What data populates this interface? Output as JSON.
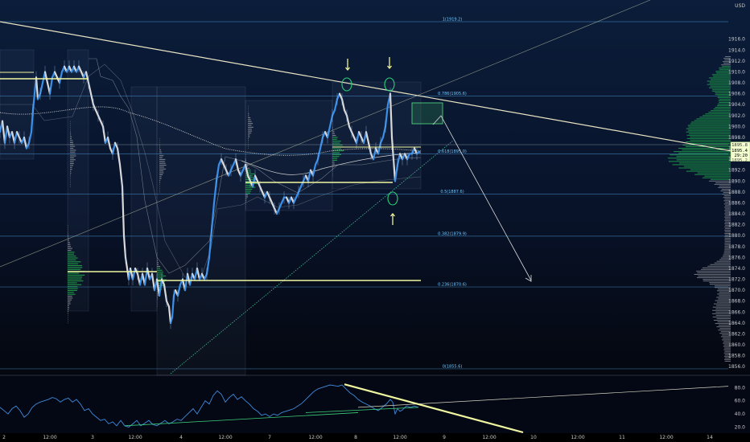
{
  "chart_data": {
    "type": "line",
    "currency": "USD",
    "price_axis": {
      "ylim": [
        1855,
        1922
      ],
      "ticks": [
        "1916.0",
        "1914.0",
        "1912.0",
        "1910.0",
        "1908.0",
        "1906.0",
        "1904.0",
        "1902.0",
        "1900.0",
        "1898.0",
        "1896.0",
        "1894.0",
        "1892.0",
        "1890.0",
        "1888.0",
        "1886.0",
        "1884.0",
        "1882.0",
        "1880.0",
        "1878.0",
        "1876.0",
        "1874.0",
        "1872.0",
        "1870.0",
        "1868.0",
        "1866.0",
        "1864.0",
        "1862.0",
        "1860.0",
        "1858.0",
        "1856.0"
      ]
    },
    "time_axis": {
      "labels": [
        "2",
        "12:00",
        "3",
        "12:00",
        "4",
        "12:00",
        "7",
        "12:00",
        "8",
        "12:00",
        "9",
        "12:00",
        "10",
        "12:00",
        "11",
        "12:00",
        "14"
      ]
    },
    "last_price": {
      "value": 1895.4,
      "label": "1895.4",
      "countdown": "29:20",
      "high_label": "1895.8",
      "low_label": "1895.2"
    },
    "fib_levels": [
      {
        "ratio": "1",
        "price": 1919.2,
        "label": "1(1919.2)"
      },
      {
        "ratio": "0.786",
        "price": 1905.6,
        "label": "0.786(1905.6)"
      },
      {
        "ratio": "0.618",
        "price": 1895.0,
        "label": "0.618(1895.0)"
      },
      {
        "ratio": "0.5",
        "price": 1887.6,
        "label": "0.5(1887.6)"
      },
      {
        "ratio": "0.382",
        "price": 1879.9,
        "label": "0.382(1879.9)"
      },
      {
        "ratio": "0.236",
        "price": 1870.6,
        "label": "0.236(1870.6)"
      },
      {
        "ratio": "0",
        "price": 1855.6,
        "label": "0(1855.6)"
      }
    ],
    "price_series": [
      [
        0,
        1899
      ],
      [
        3,
        1901
      ],
      [
        6,
        1897
      ],
      [
        9,
        1900
      ],
      [
        12,
        1898
      ],
      [
        15,
        1899
      ],
      [
        18,
        1897
      ],
      [
        21,
        1899
      ],
      [
        24,
        1898
      ],
      [
        27,
        1897
      ],
      [
        30,
        1898
      ],
      [
        33,
        1896
      ],
      [
        36,
        1897
      ],
      [
        39,
        1899
      ],
      [
        41,
        1903
      ],
      [
        43,
        1906
      ],
      [
        45,
        1909
      ],
      [
        47,
        1905
      ],
      [
        50,
        1906
      ],
      [
        53,
        1908
      ],
      [
        56,
        1910
      ],
      [
        59,
        1908
      ],
      [
        62,
        1906
      ],
      [
        65,
        1909
      ],
      [
        68,
        1910
      ],
      [
        71,
        1909
      ],
      [
        74,
        1908
      ],
      [
        77,
        1910
      ],
      [
        80,
        1911
      ],
      [
        83,
        1910
      ],
      [
        86,
        1911
      ],
      [
        89,
        1910
      ],
      [
        92,
        1911
      ],
      [
        95,
        1910
      ],
      [
        98,
        1911
      ],
      [
        101,
        1910
      ],
      [
        104,
        1909
      ],
      [
        107,
        1910
      ],
      [
        110,
        1908
      ],
      [
        113,
        1906
      ],
      [
        116,
        1904
      ],
      [
        119,
        1903
      ],
      [
        122,
        1902
      ],
      [
        125,
        1901
      ],
      [
        128,
        1900
      ],
      [
        131,
        1897
      ],
      [
        134,
        1898
      ],
      [
        137,
        1896
      ],
      [
        140,
        1895
      ],
      [
        143,
        1897
      ],
      [
        146,
        1896
      ],
      [
        149,
        1893
      ],
      [
        152,
        1889
      ],
      [
        154,
        1880
      ],
      [
        156,
        1876
      ],
      [
        158,
        1874
      ],
      [
        160,
        1872
      ],
      [
        162,
        1874
      ],
      [
        165,
        1872
      ],
      [
        168,
        1874
      ],
      [
        171,
        1873
      ],
      [
        174,
        1871
      ],
      [
        177,
        1873
      ],
      [
        180,
        1871
      ],
      [
        183,
        1874
      ],
      [
        186,
        1872
      ],
      [
        189,
        1873
      ],
      [
        192,
        1870
      ],
      [
        195,
        1872
      ],
      [
        198,
        1869
      ],
      [
        201,
        1872
      ],
      [
        204,
        1871
      ],
      [
        207,
        1868
      ],
      [
        210,
        1867
      ],
      [
        212,
        1864
      ],
      [
        214,
        1865
      ],
      [
        216,
        1869
      ],
      [
        218,
        1870
      ],
      [
        221,
        1869
      ],
      [
        224,
        1871
      ],
      [
        227,
        1872
      ],
      [
        230,
        1870
      ],
      [
        233,
        1873
      ],
      [
        236,
        1871
      ],
      [
        239,
        1873
      ],
      [
        242,
        1872
      ],
      [
        245,
        1874
      ],
      [
        248,
        1872
      ],
      [
        251,
        1873
      ],
      [
        254,
        1872
      ],
      [
        257,
        1873
      ],
      [
        260,
        1876
      ],
      [
        263,
        1881
      ],
      [
        266,
        1886
      ],
      [
        269,
        1890
      ],
      [
        272,
        1893
      ],
      [
        275,
        1894
      ],
      [
        278,
        1893
      ],
      [
        281,
        1892
      ],
      [
        284,
        1891
      ],
      [
        287,
        1892
      ],
      [
        290,
        1893
      ],
      [
        293,
        1894
      ],
      [
        296,
        1892
      ],
      [
        299,
        1891
      ],
      [
        302,
        1892
      ],
      [
        305,
        1893
      ],
      [
        308,
        1891
      ],
      [
        311,
        1890
      ],
      [
        314,
        1889
      ],
      [
        317,
        1891
      ],
      [
        320,
        1890
      ],
      [
        323,
        1889
      ],
      [
        326,
        1888
      ],
      [
        329,
        1887
      ],
      [
        332,
        1888
      ],
      [
        335,
        1887
      ],
      [
        338,
        1886
      ],
      [
        341,
        1885
      ],
      [
        344,
        1884
      ],
      [
        347,
        1885
      ],
      [
        350,
        1886
      ],
      [
        353,
        1887
      ],
      [
        356,
        1887
      ],
      [
        359,
        1886
      ],
      [
        362,
        1887
      ],
      [
        365,
        1886
      ],
      [
        368,
        1887
      ],
      [
        371,
        1888
      ],
      [
        374,
        1889
      ],
      [
        377,
        1890
      ],
      [
        380,
        1891
      ],
      [
        383,
        1890
      ],
      [
        386,
        1892
      ],
      [
        389,
        1891
      ],
      [
        392,
        1893
      ],
      [
        395,
        1894
      ],
      [
        398,
        1896
      ],
      [
        401,
        1898
      ],
      [
        404,
        1899
      ],
      [
        407,
        1898
      ],
      [
        410,
        1900
      ],
      [
        413,
        1902
      ],
      [
        416,
        1903
      ],
      [
        419,
        1905
      ],
      [
        422,
        1906
      ],
      [
        425,
        1905
      ],
      [
        428,
        1903
      ],
      [
        431,
        1902
      ],
      [
        434,
        1900
      ],
      [
        437,
        1899
      ],
      [
        440,
        1898
      ],
      [
        443,
        1897
      ],
      [
        446,
        1899
      ],
      [
        449,
        1898
      ],
      [
        452,
        1897
      ],
      [
        455,
        1899
      ],
      [
        458,
        1897
      ],
      [
        461,
        1895
      ],
      [
        464,
        1894
      ],
      [
        467,
        1896
      ],
      [
        470,
        1895
      ],
      [
        473,
        1897
      ],
      [
        476,
        1898
      ],
      [
        479,
        1900
      ],
      [
        482,
        1904
      ],
      [
        485,
        1906
      ],
      [
        487,
        1898
      ],
      [
        489,
        1894
      ],
      [
        491,
        1890
      ],
      [
        494,
        1893
      ],
      [
        497,
        1895
      ],
      [
        500,
        1894
      ],
      [
        503,
        1895
      ],
      [
        506,
        1894
      ],
      [
        509,
        1895
      ],
      [
        512,
        1895
      ],
      [
        515,
        1896
      ],
      [
        518,
        1895
      ],
      [
        521,
        1895.4
      ]
    ],
    "oscillator": {
      "ylim": [
        12,
        95
      ],
      "ticks": [
        "80.0",
        "60.0",
        "40.0",
        "20.0"
      ],
      "values": [
        [
          0,
          50
        ],
        [
          5,
          45
        ],
        [
          10,
          40
        ],
        [
          15,
          48
        ],
        [
          20,
          52
        ],
        [
          25,
          45
        ],
        [
          30,
          35
        ],
        [
          35,
          40
        ],
        [
          40,
          50
        ],
        [
          45,
          55
        ],
        [
          50,
          58
        ],
        [
          55,
          60
        ],
        [
          60,
          62
        ],
        [
          65,
          65
        ],
        [
          70,
          63
        ],
        [
          75,
          58
        ],
        [
          80,
          62
        ],
        [
          85,
          64
        ],
        [
          90,
          58
        ],
        [
          95,
          62
        ],
        [
          100,
          55
        ],
        [
          105,
          45
        ],
        [
          110,
          48
        ],
        [
          115,
          40
        ],
        [
          120,
          35
        ],
        [
          125,
          30
        ],
        [
          130,
          32
        ],
        [
          135,
          25
        ],
        [
          140,
          28
        ],
        [
          145,
          22
        ],
        [
          150,
          30
        ],
        [
          155,
          22
        ],
        [
          160,
          20
        ],
        [
          165,
          25
        ],
        [
          170,
          30
        ],
        [
          175,
          22
        ],
        [
          180,
          26
        ],
        [
          185,
          30
        ],
        [
          190,
          24
        ],
        [
          195,
          22
        ],
        [
          200,
          26
        ],
        [
          205,
          30
        ],
        [
          210,
          25
        ],
        [
          215,
          28
        ],
        [
          220,
          32
        ],
        [
          225,
          30
        ],
        [
          230,
          36
        ],
        [
          235,
          42
        ],
        [
          240,
          48
        ],
        [
          245,
          40
        ],
        [
          250,
          50
        ],
        [
          255,
          60
        ],
        [
          260,
          55
        ],
        [
          265,
          68
        ],
        [
          270,
          75
        ],
        [
          275,
          70
        ],
        [
          280,
          58
        ],
        [
          285,
          65
        ],
        [
          290,
          70
        ],
        [
          295,
          62
        ],
        [
          300,
          66
        ],
        [
          305,
          60
        ],
        [
          310,
          55
        ],
        [
          315,
          48
        ],
        [
          320,
          44
        ],
        [
          325,
          38
        ],
        [
          330,
          40
        ],
        [
          335,
          36
        ],
        [
          340,
          40
        ],
        [
          345,
          38
        ],
        [
          350,
          42
        ],
        [
          355,
          44
        ],
        [
          360,
          46
        ],
        [
          365,
          48
        ],
        [
          370,
          52
        ],
        [
          375,
          56
        ],
        [
          380,
          62
        ],
        [
          385,
          68
        ],
        [
          390,
          74
        ],
        [
          395,
          78
        ],
        [
          400,
          80
        ],
        [
          405,
          82
        ],
        [
          410,
          84
        ],
        [
          415,
          83
        ],
        [
          420,
          82
        ],
        [
          425,
          84
        ],
        [
          430,
          78
        ],
        [
          435,
          72
        ],
        [
          440,
          68
        ],
        [
          445,
          62
        ],
        [
          450,
          58
        ],
        [
          455,
          55
        ],
        [
          460,
          52
        ],
        [
          465,
          48
        ],
        [
          470,
          45
        ],
        [
          475,
          50
        ],
        [
          480,
          55
        ],
        [
          485,
          62
        ],
        [
          488,
          58
        ],
        [
          491,
          40
        ],
        [
          494,
          48
        ],
        [
          497,
          44
        ],
        [
          500,
          46
        ],
        [
          505,
          52
        ],
        [
          510,
          50
        ],
        [
          515,
          52
        ],
        [
          520,
          50
        ]
      ]
    },
    "grid": false,
    "legend": "none"
  }
}
